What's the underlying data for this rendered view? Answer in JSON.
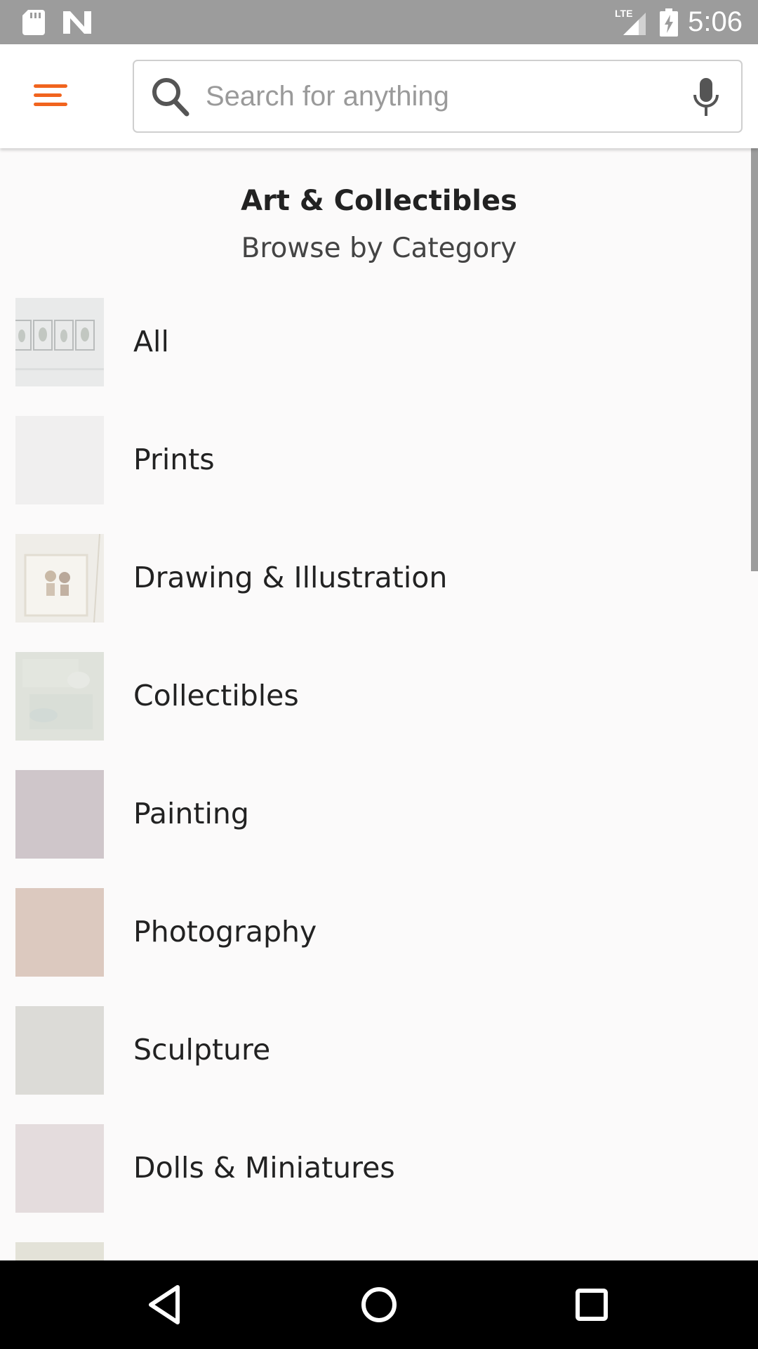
{
  "status_bar": {
    "time": "5:06",
    "network_label": "LTE",
    "background_color": "#9c9c9c",
    "icons": [
      "sd-card-icon",
      "n-notification-icon",
      "lte-signal-icon",
      "battery-charging-icon"
    ]
  },
  "app_bar": {
    "menu_icon": "hamburger-menu-icon",
    "accent_color": "#f1641e",
    "search": {
      "placeholder": "Search for anything",
      "value": "",
      "left_icon": "search-icon",
      "right_icon": "microphone-icon"
    }
  },
  "main": {
    "title": "Art & Collectibles",
    "subtitle": "Browse by Category",
    "categories": [
      {
        "label": "All",
        "thumb_color": "#e9eaea"
      },
      {
        "label": "Prints",
        "thumb_color": "#f0efef"
      },
      {
        "label": "Drawing & Illustration",
        "thumb_color": "#efede8"
      },
      {
        "label": "Collectibles",
        "thumb_color": "#dfe2db"
      },
      {
        "label": "Painting",
        "thumb_color": "#cfc6ca"
      },
      {
        "label": "Photography",
        "thumb_color": "#dcc9bf"
      },
      {
        "label": "Sculpture",
        "thumb_color": "#dcdbd7"
      },
      {
        "label": "Dolls & Miniatures",
        "thumb_color": "#e4dcdd"
      },
      {
        "label": "",
        "thumb_color": "#e3e2d8"
      }
    ]
  },
  "nav_bar": {
    "icons": [
      "back-icon",
      "home-icon",
      "recents-icon"
    ]
  }
}
